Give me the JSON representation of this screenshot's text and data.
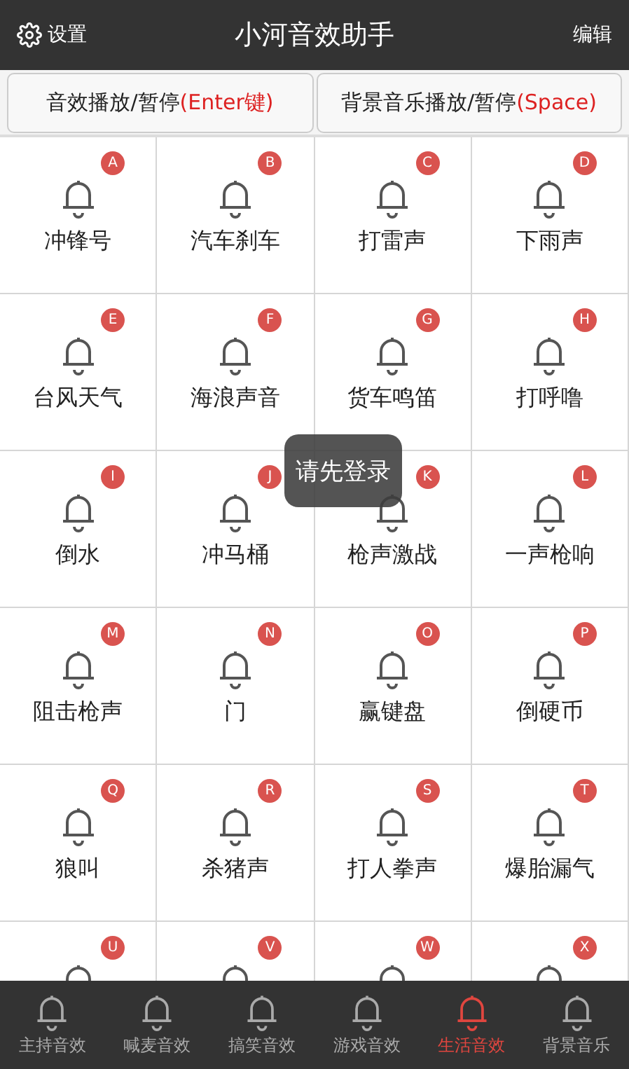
{
  "header": {
    "settings_label": "设置",
    "title": "小河音效助手",
    "edit_label": "编辑"
  },
  "controls": [
    {
      "label": "音效播放/暂停",
      "shortcut": "(Enter键)"
    },
    {
      "label": "背景音乐播放/暂停",
      "shortcut": "(Space)"
    }
  ],
  "sounds": [
    {
      "name": "冲锋号",
      "key": "A"
    },
    {
      "name": "汽车刹车",
      "key": "B"
    },
    {
      "name": "打雷声",
      "key": "C"
    },
    {
      "name": "下雨声",
      "key": "D"
    },
    {
      "name": "台风天气",
      "key": "E"
    },
    {
      "name": "海浪声音",
      "key": "F"
    },
    {
      "name": "货车鸣笛",
      "key": "G"
    },
    {
      "name": "打呼噜",
      "key": "H"
    },
    {
      "name": "倒水",
      "key": "I"
    },
    {
      "name": "冲马桶",
      "key": "J"
    },
    {
      "name": "枪声激战",
      "key": "K"
    },
    {
      "name": "一声枪响",
      "key": "L"
    },
    {
      "name": "阻击枪声",
      "key": "M"
    },
    {
      "name": "门",
      "key": "N"
    },
    {
      "name": "赢键盘",
      "key": "O"
    },
    {
      "name": "倒硬币",
      "key": "P"
    },
    {
      "name": "狼叫",
      "key": "Q"
    },
    {
      "name": "杀猪声",
      "key": "R"
    },
    {
      "name": "打人拳声",
      "key": "S"
    },
    {
      "name": "爆胎漏气",
      "key": "T"
    },
    {
      "key": "U"
    },
    {
      "key": "V"
    },
    {
      "key": "W"
    },
    {
      "key": "X"
    }
  ],
  "toast": "请先登录",
  "tabs": [
    {
      "label": "主持音效",
      "selected": false
    },
    {
      "label": "喊麦音效",
      "selected": false
    },
    {
      "label": "搞笑音效",
      "selected": false
    },
    {
      "label": "游戏音效",
      "selected": false
    },
    {
      "label": "生活音效",
      "selected": true
    },
    {
      "label": "背景音乐",
      "selected": false
    }
  ]
}
